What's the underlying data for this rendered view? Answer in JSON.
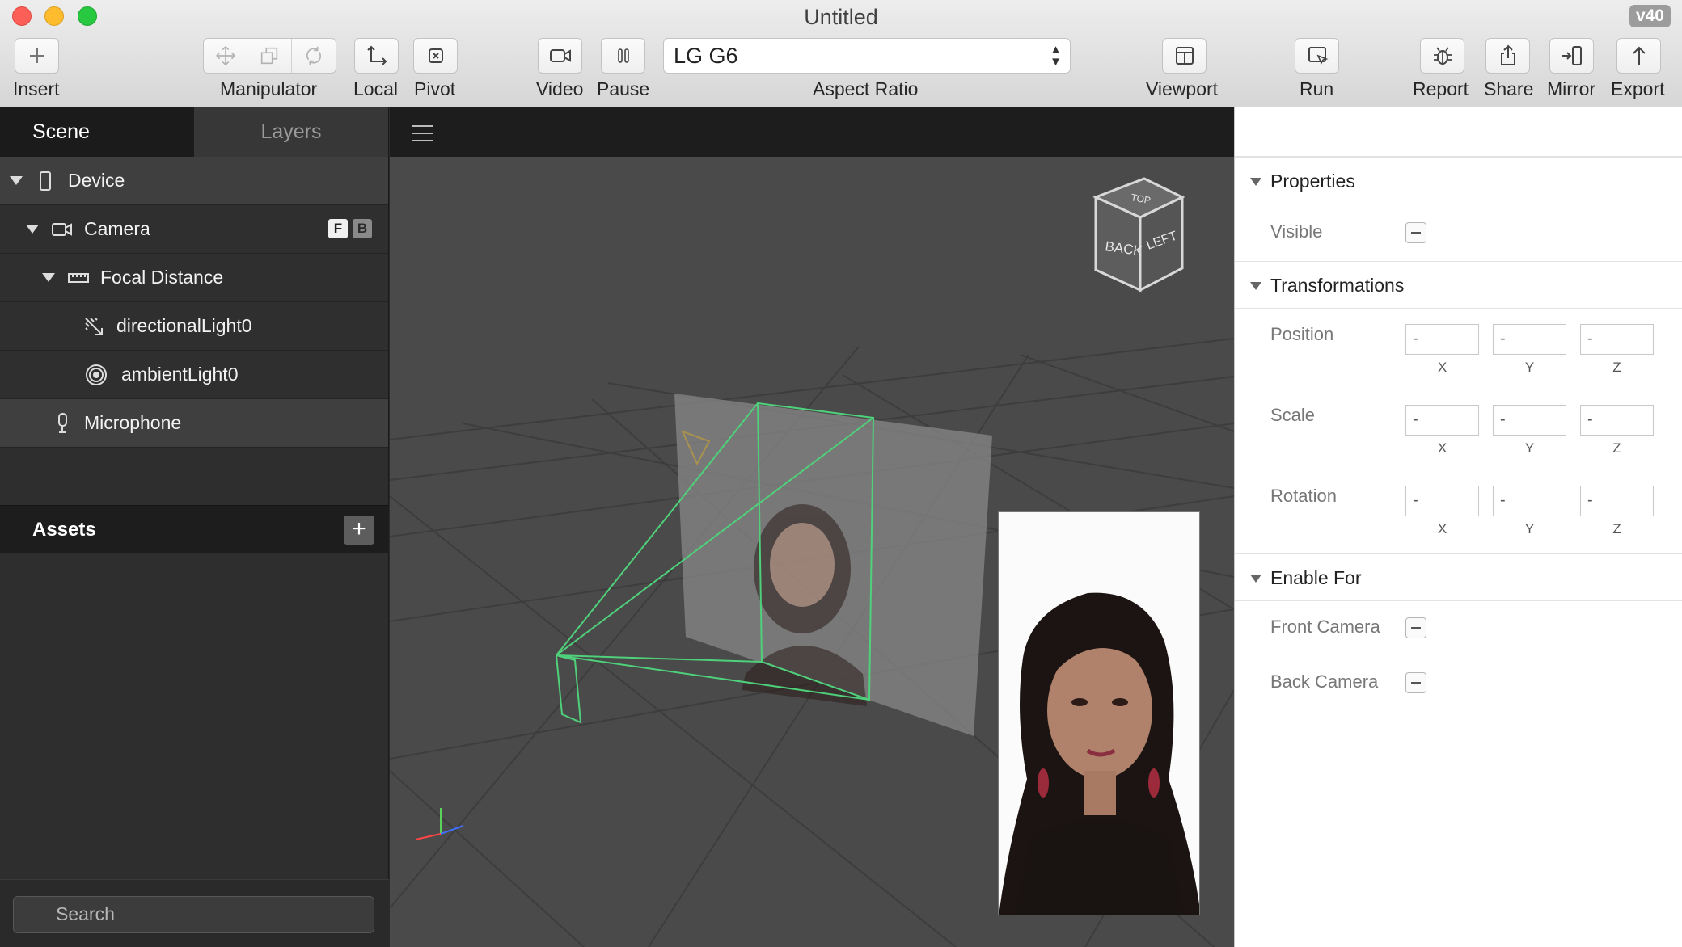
{
  "window": {
    "title": "Untitled",
    "version": "v40"
  },
  "toolbar": {
    "insert": "Insert",
    "manipulator": "Manipulator",
    "local": "Local",
    "pivot": "Pivot",
    "video": "Video",
    "pause": "Pause",
    "aspect_ratio_value": "LG G6",
    "aspect_ratio_label": "Aspect Ratio",
    "viewport": "Viewport",
    "run": "Run",
    "report": "Report",
    "share": "Share",
    "mirror": "Mirror",
    "export": "Export"
  },
  "left_panel": {
    "tabs": [
      "Scene",
      "Layers"
    ],
    "active_tab": "Scene",
    "tree": [
      {
        "label": "Device",
        "icon": "phone-icon",
        "expanded": true
      },
      {
        "label": "Camera",
        "icon": "camera-icon",
        "expanded": true,
        "badges": [
          "F",
          "B"
        ]
      },
      {
        "label": "Focal Distance",
        "icon": "ruler-icon",
        "expanded": true
      },
      {
        "label": "directionalLight0",
        "icon": "directional-light-icon"
      },
      {
        "label": "ambientLight0",
        "icon": "ambient-light-icon"
      },
      {
        "label": "Microphone",
        "icon": "microphone-icon"
      }
    ],
    "assets_title": "Assets",
    "assets_add": "+",
    "search_placeholder": "Search"
  },
  "viewport": {
    "view_cube": {
      "faces": [
        "BACK",
        "LEFT",
        "TOP"
      ]
    },
    "preview_subject": "woman-portrait"
  },
  "right_panel": {
    "properties": {
      "title": "Properties",
      "visible_label": "Visible"
    },
    "transformations": {
      "title": "Transformations",
      "rows": [
        {
          "label": "Position",
          "x": "-",
          "y": "-",
          "z": "-"
        },
        {
          "label": "Scale",
          "x": "-",
          "y": "-",
          "z": "-"
        },
        {
          "label": "Rotation",
          "x": "-",
          "y": "-",
          "z": "-"
        }
      ],
      "axes": [
        "X",
        "Y",
        "Z"
      ]
    },
    "enable_for": {
      "title": "Enable For",
      "front_camera": "Front Camera",
      "back_camera": "Back Camera"
    }
  },
  "colors": {
    "camera_frustum": "#4fd07a",
    "viewport_bg": "#4a4a4a",
    "toolbar_bg": "#e3e3e3"
  }
}
